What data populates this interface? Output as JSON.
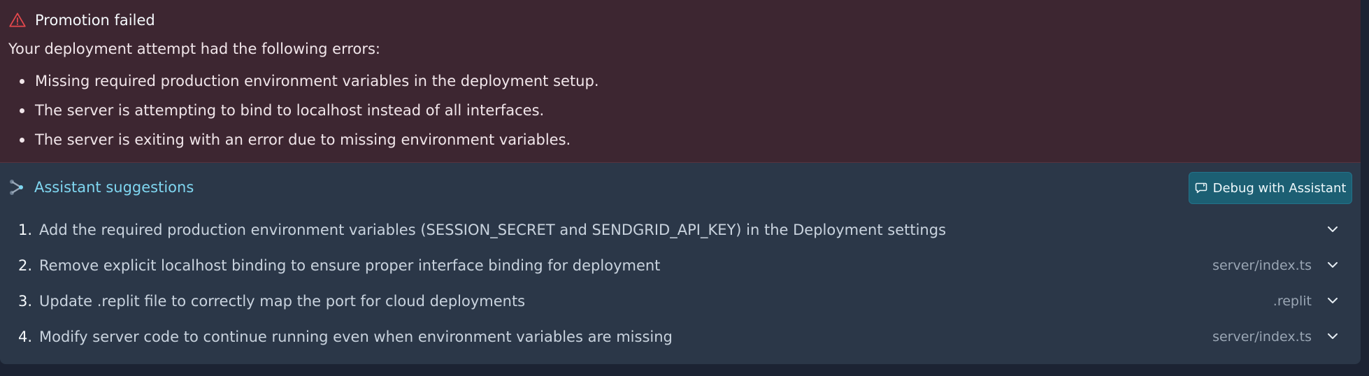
{
  "error": {
    "title": "Promotion failed",
    "icon": "warning-triangle-icon",
    "intro": "Your deployment attempt had the following errors:",
    "items": [
      "Missing required production environment variables in the deployment setup.",
      "The server is attempting to bind to localhost instead of all interfaces.",
      "The server is exiting with an error due to missing environment variables."
    ]
  },
  "assistant": {
    "title": "Assistant suggestions",
    "icon": "assistant-icon",
    "debug_button": "Debug with Assistant",
    "suggestions": [
      {
        "num": "1.",
        "text": "Add the required production environment variables (SESSION_SECRET and SENDGRID_API_KEY) in the Deployment settings",
        "file": ""
      },
      {
        "num": "2.",
        "text": "Remove explicit localhost binding to ensure proper interface binding for deployment",
        "file": "server/index.ts"
      },
      {
        "num": "3.",
        "text": "Update .replit file to correctly map the port for cloud deployments",
        "file": ".replit"
      },
      {
        "num": "4.",
        "text": "Modify server code to continue running even when environment variables are missing",
        "file": "server/index.ts"
      }
    ]
  },
  "colors": {
    "error_bg": "#3d2631",
    "assistant_bg": "#2b3748",
    "accent": "#7fd6f0",
    "button_bg": "#1c5f73",
    "warning": "#e5484d"
  }
}
